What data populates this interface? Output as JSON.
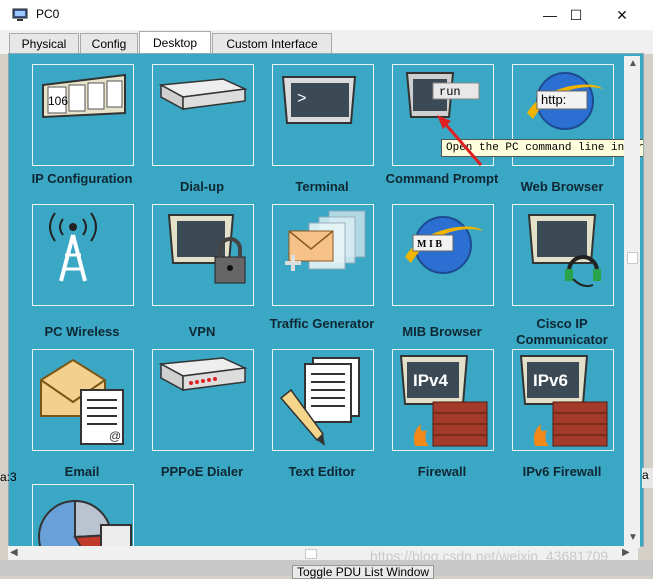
{
  "window": {
    "title": "PC0",
    "minimize_glyph": "—",
    "maximize_glyph": "☐",
    "close_glyph": "✕"
  },
  "tabs": [
    {
      "label": "Physical"
    },
    {
      "label": "Config"
    },
    {
      "label": "Desktop"
    },
    {
      "label": "Custom Interface"
    }
  ],
  "apps": [
    {
      "label": "IP Configuration",
      "icon": "ip-config-icon"
    },
    {
      "label": "Dial-up",
      "icon": "modem-icon"
    },
    {
      "label": "Terminal",
      "icon": "terminal-icon"
    },
    {
      "label": "Command Prompt",
      "icon": "command-prompt-icon"
    },
    {
      "label": "Web Browser",
      "icon": "web-browser-icon"
    },
    {
      "label": "PC Wireless",
      "icon": "wireless-tower-icon"
    },
    {
      "label": "VPN",
      "icon": "vpn-lock-icon"
    },
    {
      "label": "Traffic Generator",
      "icon": "traffic-generator-icon"
    },
    {
      "label": "MIB Browser",
      "icon": "mib-browser-icon"
    },
    {
      "label": "Cisco IP Communicator",
      "icon": "ip-communicator-icon"
    },
    {
      "label": "Email",
      "icon": "email-icon"
    },
    {
      "label": "PPPoE Dialer",
      "icon": "pppoe-dialer-icon"
    },
    {
      "label": "Text Editor",
      "icon": "text-editor-icon"
    },
    {
      "label": "Firewall",
      "icon": "firewall-icon"
    },
    {
      "label": "IPv6 Firewall",
      "icon": "ipv6-firewall-icon"
    },
    {
      "label": "",
      "icon": "pie-chart-icon"
    }
  ],
  "icon_text": {
    "ip_config": "106",
    "terminal": ">",
    "command_prompt": "run",
    "web_browser": "http:",
    "mib": "M I B",
    "ipv4": "IPv4",
    "ipv6": "IPv6"
  },
  "tooltip": {
    "text": "Open the PC command line interface"
  },
  "taskbar": {
    "pdu_label": "Toggle PDU List Window"
  },
  "watermark": {
    "text": "https://blog.csdn.net/weixin_43681709"
  },
  "edges": {
    "left_fragment": "a:3",
    "right_fragment": "a"
  },
  "colors": {
    "desktop_bg": "#3aa7c4",
    "label_color": "#0f2733",
    "tooltip_bg": "#ffffdd"
  }
}
